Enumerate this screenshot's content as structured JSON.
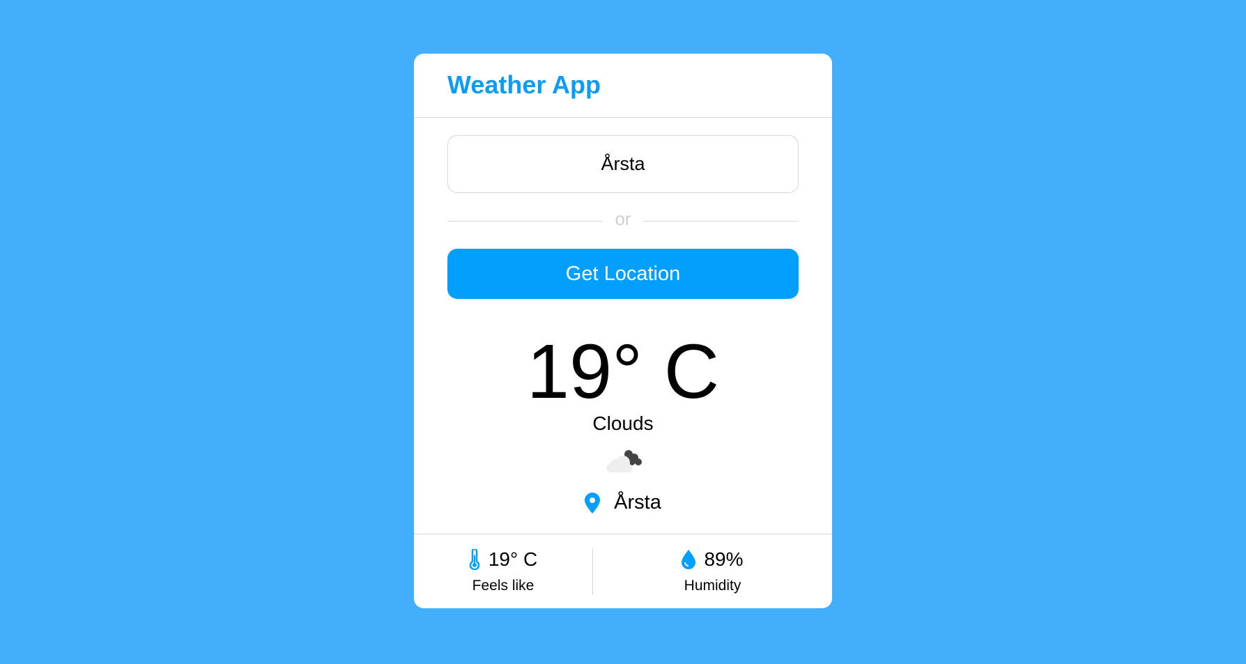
{
  "app": {
    "title": "Weather App",
    "accent_color": "#039ffc",
    "background_color": "#43aefc"
  },
  "search": {
    "value": "Årsta"
  },
  "divider": {
    "text": "or"
  },
  "location_button": {
    "label": "Get Location"
  },
  "weather": {
    "temperature": "19° C",
    "description": "Clouds",
    "icon": "broken-clouds-icon",
    "location": "Årsta",
    "location_icon": "map-pin-icon"
  },
  "details": [
    {
      "icon": "thermometer-icon",
      "value": "19° C",
      "label": "Feels like"
    },
    {
      "icon": "water-drop-icon",
      "value": "89%",
      "label": "Humidity"
    }
  ]
}
